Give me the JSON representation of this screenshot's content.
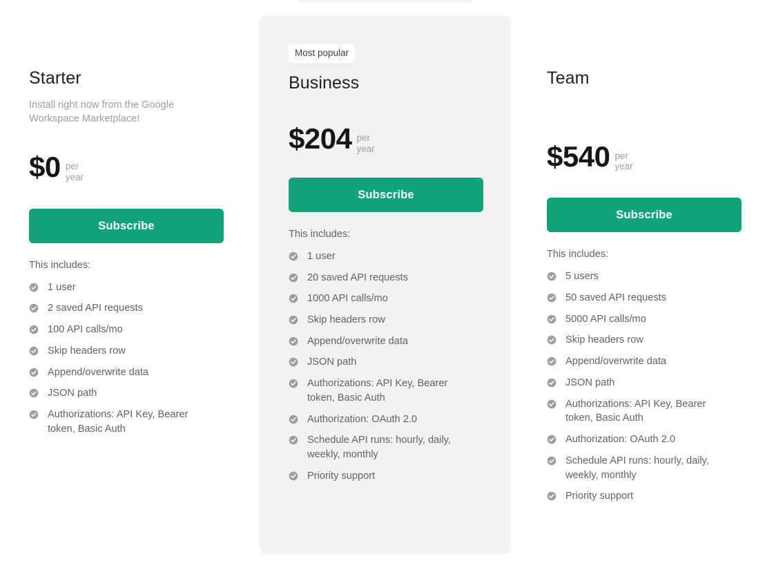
{
  "theme": {
    "page_background": "#ffffff",
    "featured_card_background": "#f2f2f3",
    "button_color": "#0fa47c",
    "button_text_color": "#ffffff",
    "check_icon_color": "#9e9e9e",
    "title_color": "#202124",
    "body_text_color": "#5f6368",
    "muted_text_color": "#9aa0a6",
    "badge_background": "#ffffff",
    "badge_text_color": "#3c4043"
  },
  "includes_label": "This includes:",
  "plans": [
    {
      "id": "starter",
      "featured": false,
      "badge": null,
      "title": "Starter",
      "subtitle": "Install right now from the Google Workspace Marketplace!",
      "price": "$0",
      "period_line1": "per",
      "period_line2": "year",
      "cta_label": "Subscribe",
      "features": [
        "1 user",
        "2 saved API requests",
        "100 API calls/mo",
        "Skip headers row",
        "Append/overwrite data",
        "JSON path",
        "Authorizations: API Key, Bearer token, Basic Auth"
      ]
    },
    {
      "id": "business",
      "featured": true,
      "badge": "Most popular",
      "title": "Business",
      "subtitle": null,
      "price": "$204",
      "period_line1": "per",
      "period_line2": "year",
      "cta_label": "Subscribe",
      "features": [
        "1 user",
        "20 saved API requests",
        "1000 API calls/mo",
        "Skip headers row",
        "Append/overwrite data",
        "JSON path",
        "Authorizations: API Key, Bearer token, Basic Auth",
        "Authorization: OAuth 2.0",
        "Schedule API runs: hourly, daily, weekly, monthly",
        "Priority support"
      ]
    },
    {
      "id": "team",
      "featured": false,
      "badge": null,
      "title": "Team",
      "subtitle": null,
      "price": "$540",
      "period_line1": "per",
      "period_line2": "year",
      "cta_label": "Subscribe",
      "features": [
        "5 users",
        "50 saved API requests",
        "5000 API calls/mo",
        "Skip headers row",
        "Append/overwrite data",
        "JSON path",
        "Authorizations: API Key, Bearer token, Basic Auth",
        "Authorization: OAuth 2.0",
        "Schedule API runs: hourly, daily, weekly, monthly",
        "Priority support"
      ]
    }
  ]
}
